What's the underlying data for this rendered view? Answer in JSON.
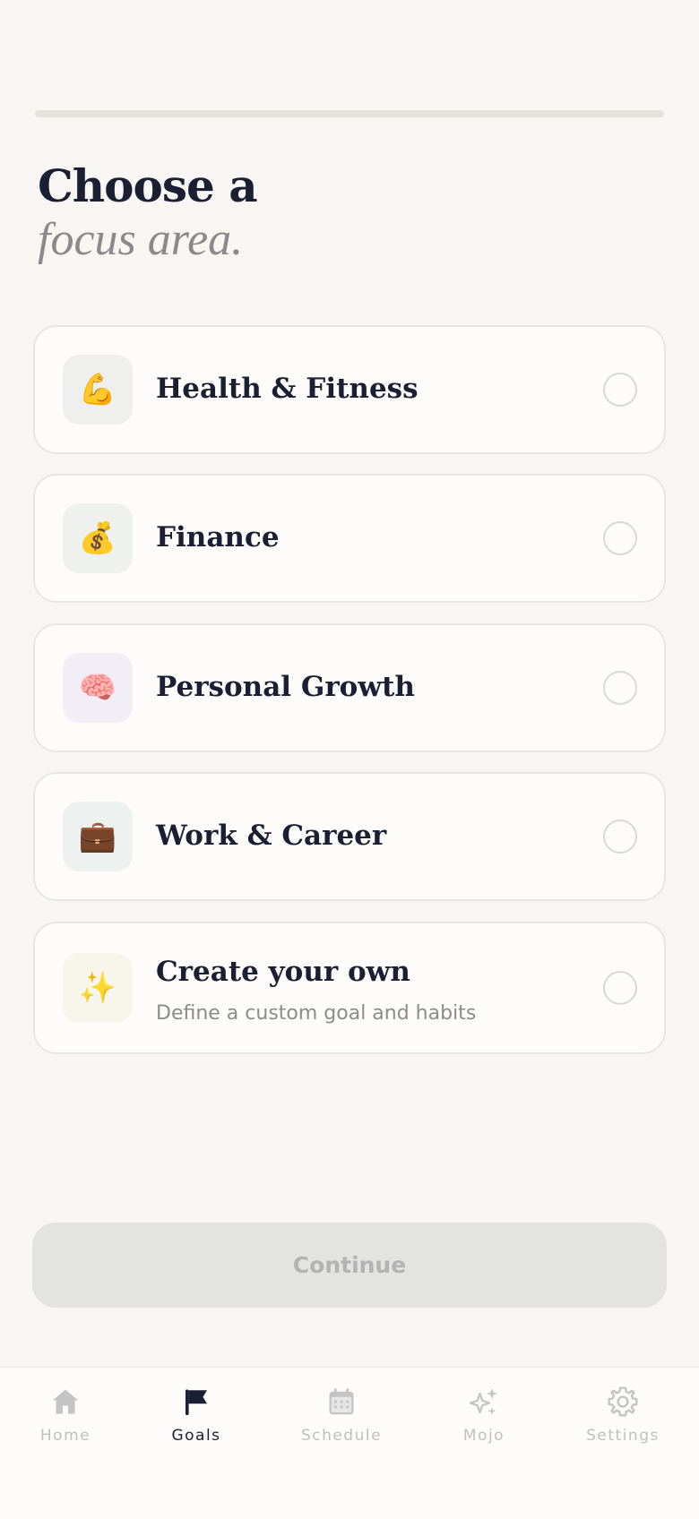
{
  "progress": {
    "fraction": 0
  },
  "header": {
    "title_line1": "Choose a",
    "title_line2": "focus area."
  },
  "options": [
    {
      "label": "Health & Fitness",
      "icon": "flexed-biceps-icon",
      "emoji": "💪",
      "icon_bg": "#efefee"
    },
    {
      "label": "Finance",
      "icon": "money-bag-icon",
      "emoji": "💰",
      "icon_bg": "#eef1ee"
    },
    {
      "label": "Personal Growth",
      "icon": "brain-icon",
      "emoji": "🧠",
      "icon_bg": "#f2eef5"
    },
    {
      "label": "Work & Career",
      "icon": "briefcase-icon",
      "emoji": "💼",
      "icon_bg": "#edf1ef"
    },
    {
      "label": "Create your own",
      "description": "Define a custom goal and habits",
      "icon": "sparkles-icon",
      "emoji": "✨",
      "icon_bg": "#f8f5ec"
    }
  ],
  "continue_label": "Continue",
  "tabs": [
    {
      "label": "Home",
      "icon": "home-icon"
    },
    {
      "label": "Goals",
      "icon": "flag-icon",
      "active": true
    },
    {
      "label": "Schedule",
      "icon": "calendar-icon"
    },
    {
      "label": "Mojo",
      "icon": "sparkle-icon"
    },
    {
      "label": "Settings",
      "icon": "gear-icon"
    }
  ],
  "colors": {
    "background": "#f7f6f3",
    "text": "#1b1f33",
    "subtitle": "#8a8a8a",
    "tab_inactive": "#c0c0c0",
    "button_disabled": "#e3e3e2"
  }
}
